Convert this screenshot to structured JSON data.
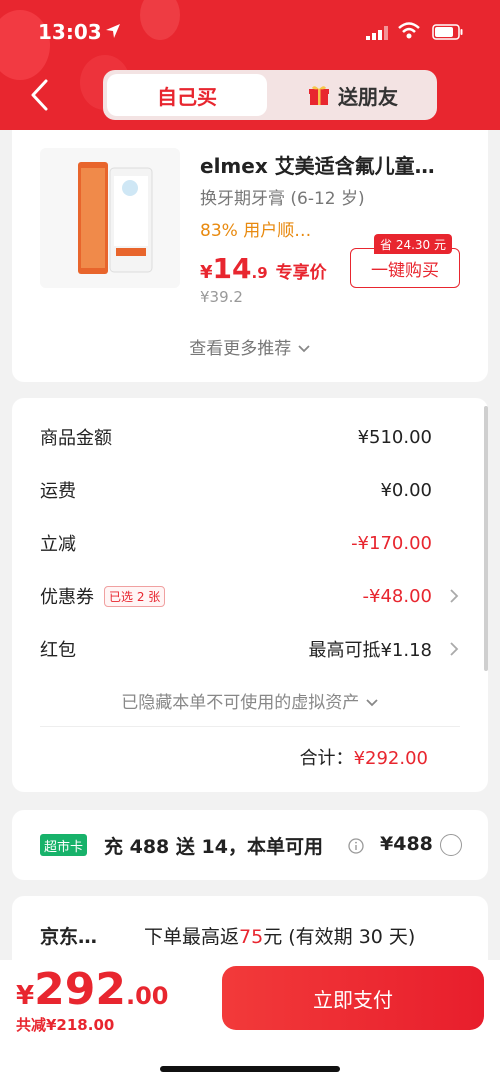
{
  "status": {
    "time": "13:03"
  },
  "tabs": {
    "self": "自己买",
    "gift": "送朋友"
  },
  "product": {
    "title": "elmex 艾美适含氟儿童…",
    "subtitle": "换牙期牙膏 (6-12 岁)",
    "rating": "83% 用户顺…",
    "price_symbol": "¥",
    "price_int": "14",
    "price_dec": ".9",
    "price_tag": "专享价",
    "original_price": "¥39.2",
    "buy_label": "一键购买",
    "save_badge": "省 24.30 元",
    "more_label": "查看更多推荐"
  },
  "summary": {
    "rows": [
      {
        "label": "商品金额",
        "value": "¥510.00"
      },
      {
        "label": "运费",
        "value": "¥0.00"
      },
      {
        "label": "立减",
        "value": "-¥170.00"
      },
      {
        "label": "优惠券",
        "tag": "已选 2 张",
        "value": "-¥48.00"
      },
      {
        "label": "红包",
        "value": "最高可抵¥1.18"
      }
    ],
    "hidden_note": "已隐藏本单不可使用的虚拟资产",
    "total_label": "合计：",
    "total_value": "¥292.00"
  },
  "supermarket": {
    "badge": "超市卡",
    "text": "充 488 送 14，本单可用",
    "price": "¥488"
  },
  "jd": {
    "name": "京东…",
    "desc_pre": "下单最高返",
    "desc_num": "75",
    "desc_post": "元 (有效期 30 天)"
  },
  "bottom": {
    "symbol": "¥",
    "int": "292",
    "dec": ".00",
    "saved": "共减¥218.00",
    "pay_label": "立即支付"
  },
  "colors": {
    "brand": "#e8262f",
    "green": "#17b26a",
    "rating": "#e88a10"
  }
}
